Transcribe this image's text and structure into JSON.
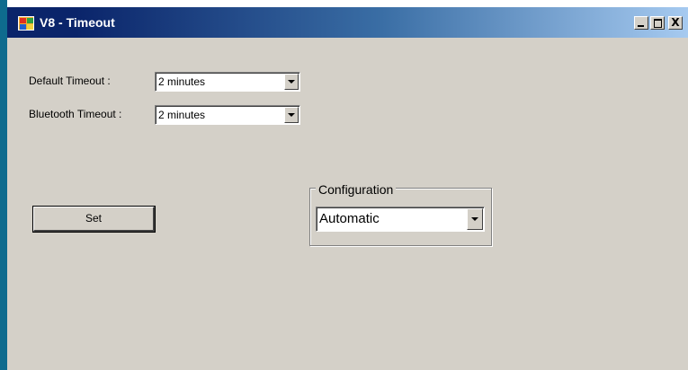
{
  "window": {
    "title": "V8 - Timeout",
    "controls": {
      "minimize": "_",
      "maximize": "□",
      "close": "X"
    }
  },
  "form": {
    "default_timeout": {
      "label": "Default Timeout :",
      "value": "2 minutes"
    },
    "bluetooth_timeout": {
      "label": "Bluetooth Timeout :",
      "value": "2 minutes"
    },
    "set_button": "Set",
    "configuration": {
      "legend": "Configuration",
      "value": "Automatic"
    }
  },
  "colors": {
    "window_bg": "#d4d0c8",
    "titlebar_start": "#0a246a",
    "titlebar_end": "#a6caf0",
    "desktop_strip": "#0e6b8e"
  },
  "icons": {
    "app": "app-window-icon",
    "dropdown": "chevron-down-icon"
  }
}
